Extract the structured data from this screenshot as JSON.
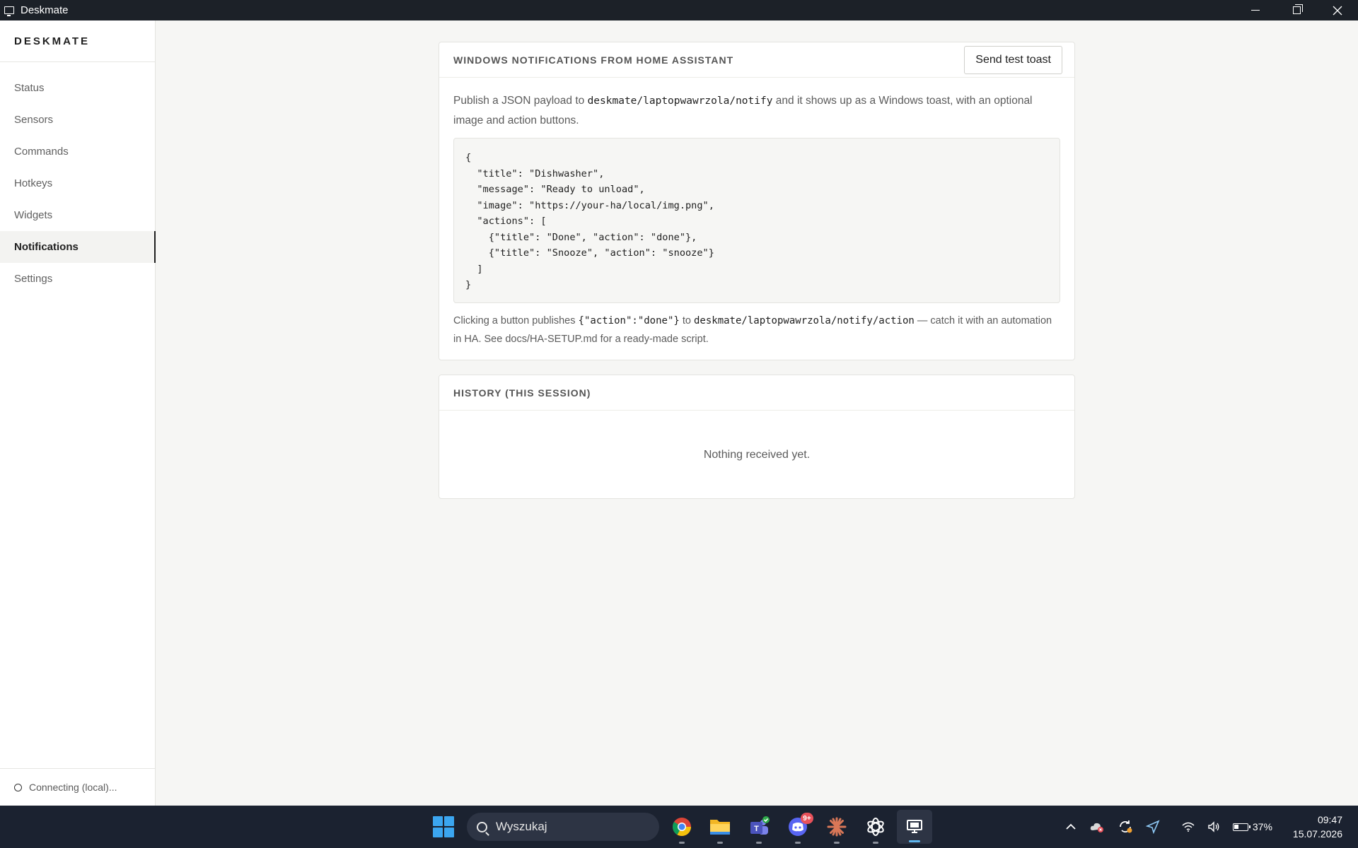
{
  "window": {
    "title": "Deskmate",
    "icon": "monitor-icon",
    "controls": [
      "minimize-icon",
      "restore-icon",
      "close-icon"
    ]
  },
  "sidebar": {
    "brand": "DESKMATE",
    "items": [
      {
        "label": "Status"
      },
      {
        "label": "Sensors"
      },
      {
        "label": "Commands"
      },
      {
        "label": "Hotkeys"
      },
      {
        "label": "Widgets"
      },
      {
        "label": "Notifications",
        "active": true
      },
      {
        "label": "Settings"
      }
    ],
    "connection_status": "Connecting (local)..."
  },
  "notifications_card": {
    "title": "WINDOWS NOTIFICATIONS FROM HOME ASSISTANT",
    "test_button": "Send test toast",
    "desc_prefix": "Publish a JSON payload to ",
    "desc_topic": "deskmate/laptopwawrzola/notify",
    "desc_suffix": " and it shows up as a Windows toast, with an optional image and action buttons.",
    "code_sample": "{\n  \"title\": \"Dishwasher\",\n  \"message\": \"Ready to unload\",\n  \"image\": \"https://your-ha/local/img.png\",\n  \"actions\": [\n    {\"title\": \"Done\", \"action\": \"done\"},\n    {\"title\": \"Snooze\", \"action\": \"snooze\"}\n  ]\n}",
    "foot_prefix": "Clicking a button publishes ",
    "foot_payload": "{\"action\":\"done\"}",
    "foot_mid": " to ",
    "foot_topic": "deskmate/laptopwawrzola/notify/action",
    "foot_suffix": " — catch it with an automation in HA. See docs/HA-SETUP.md for a ready-made script."
  },
  "history_card": {
    "title": "HISTORY (THIS SESSION)",
    "empty_text": "Nothing received yet."
  },
  "taskbar": {
    "search_placeholder": "Wyszukaj",
    "apps": [
      {
        "name": "chrome-icon"
      },
      {
        "name": "file-explorer-icon"
      },
      {
        "name": "teams-icon"
      },
      {
        "name": "discord-icon",
        "badge": "9+"
      },
      {
        "name": "claude-icon"
      },
      {
        "name": "chatgpt-icon"
      },
      {
        "name": "deskmate-icon",
        "active": true
      }
    ],
    "battery": "37%",
    "time": "09:47",
    "date": "15.07.2026"
  }
}
